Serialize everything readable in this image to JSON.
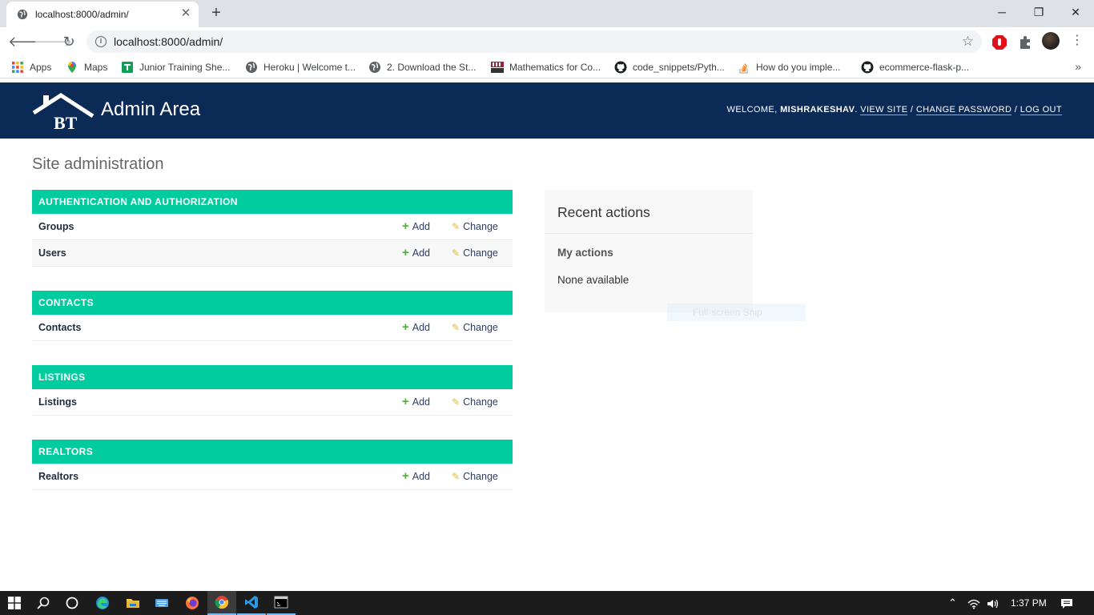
{
  "browser": {
    "tab_title": "localhost:8000/admin/",
    "url": "localhost:8000/admin/",
    "bookmarks": [
      {
        "label": "Apps",
        "icon": "apps-grid-icon"
      },
      {
        "label": "Maps",
        "icon": "maps-pin-icon"
      },
      {
        "label": "Junior Training She...",
        "icon": "sheets-icon"
      },
      {
        "label": "Heroku | Welcome t...",
        "icon": "globe-icon"
      },
      {
        "label": "2. Download the St...",
        "icon": "globe-icon"
      },
      {
        "label": "Mathematics for Co...",
        "icon": "mit-ocw-icon"
      },
      {
        "label": "code_snippets/Pyth...",
        "icon": "github-icon"
      },
      {
        "label": "How do you imple...",
        "icon": "stackoverflow-icon"
      },
      {
        "label": "ecommerce-flask-p...",
        "icon": "github-icon"
      }
    ],
    "more": "»"
  },
  "header": {
    "logo_text": "BT",
    "title": "Admin Area",
    "welcome": "Welcome,",
    "username": "mishrakeshav",
    "view_site": "View site",
    "change_password": "Change password",
    "log_out": "Log out"
  },
  "page_title": "Site administration",
  "modules": [
    {
      "caption": "Authentication and Authorization",
      "models": [
        "Groups",
        "Users"
      ]
    },
    {
      "caption": "Contacts",
      "models": [
        "Contacts"
      ]
    },
    {
      "caption": "Listings",
      "models": [
        "Listings"
      ]
    },
    {
      "caption": "Realtors",
      "models": [
        "Realtors"
      ]
    }
  ],
  "actions": {
    "add": "Add",
    "change": "Change"
  },
  "recent_actions": {
    "title": "Recent actions",
    "subtitle": "My actions",
    "empty": "None available"
  },
  "overlay_hint": "Full-screen Snip",
  "taskbar": {
    "time": "1:37 PM"
  },
  "colors": {
    "header_bg": "#0c2a56",
    "module_caption_bg": "#00cc9f",
    "add_icon": "#4cb033",
    "change_icon": "#e8b830"
  }
}
